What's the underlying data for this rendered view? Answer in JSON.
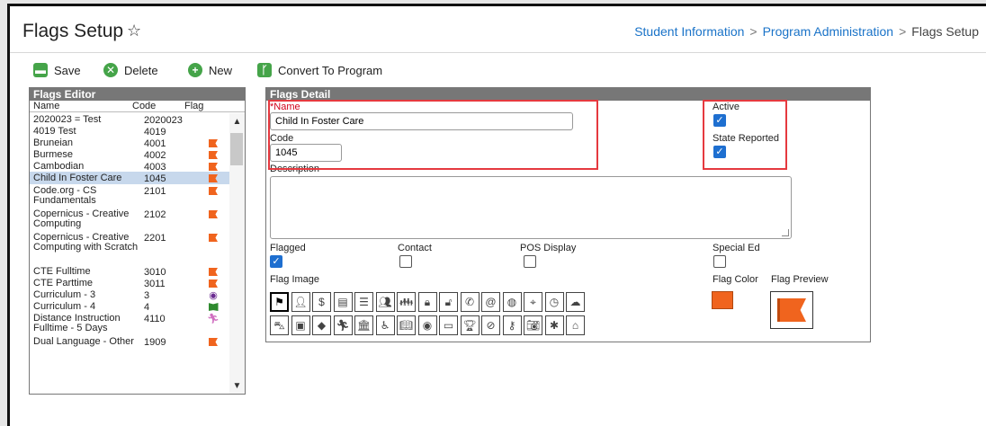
{
  "header": {
    "title": "Flags Setup",
    "breadcrumb": [
      "Student Information",
      "Program Administration",
      "Flags Setup"
    ]
  },
  "toolbar": {
    "save": "Save",
    "delete": "Delete",
    "new": "New",
    "convert": "Convert To Program"
  },
  "editor": {
    "title": "Flags Editor",
    "columns": {
      "name": "Name",
      "code": "Code",
      "flag": "Flag"
    },
    "rows": [
      {
        "name": "2020023 = Test",
        "code": "2020023",
        "flag": ""
      },
      {
        "name": "4019 Test",
        "code": "4019",
        "flag": ""
      },
      {
        "name": "Bruneian",
        "code": "4001",
        "flag": "flag"
      },
      {
        "name": "Burmese",
        "code": "4002",
        "flag": "flag"
      },
      {
        "name": "Cambodian",
        "code": "4003",
        "flag": "flag"
      },
      {
        "name": "Child In Foster Care",
        "code": "1045",
        "flag": "flag"
      },
      {
        "name": "Code.org - CS Fundamentals",
        "code": "2101",
        "flag": "flag"
      },
      {
        "name": "Copernicus - Creative Computing",
        "code": "2102",
        "flag": "flag"
      },
      {
        "name": "Copernicus - Creative Computing with Scratch",
        "code": "2201",
        "flag": "flag"
      },
      {
        "name": "CTE Fulltime",
        "code": "3010",
        "flag": "flag"
      },
      {
        "name": "CTE Parttime",
        "code": "3011",
        "flag": "flag"
      },
      {
        "name": "Curriculum - 3",
        "code": "3",
        "flag": "eye"
      },
      {
        "name": "Curriculum - 4",
        "code": "4",
        "flag": "book"
      },
      {
        "name": "Distance Instruction Fulltime - 5 Days",
        "code": "4110",
        "flag": "run"
      },
      {
        "name": "Dual Language - Other",
        "code": "1909",
        "flag": "flag"
      }
    ]
  },
  "detail": {
    "title": "Flags Detail",
    "name_label": "*Name",
    "name_value": "Child In Foster Care",
    "code_label": "Code",
    "code_value": "1045",
    "active_label": "Active",
    "state_reported_label": "State Reported",
    "description_label": "Description",
    "flagged_label": "Flagged",
    "contact_label": "Contact",
    "pos_display_label": "POS Display",
    "special_ed_label": "Special Ed",
    "flag_image_label": "Flag Image",
    "flag_color_label": "Flag Color",
    "flag_preview_label": "Flag Preview",
    "flag_color": "#f0641e",
    "checks": {
      "active": true,
      "state_reported": true,
      "flagged": true,
      "contact": false,
      "pos_display": false,
      "special_ed": false
    },
    "icons_row1": [
      "flag",
      "person-check",
      "dollar",
      "id-card",
      "list",
      "teacher",
      "group",
      "lock",
      "unlock",
      "phone",
      "at",
      "globe",
      "pin",
      "clock",
      "cloud"
    ],
    "icons_row2": [
      "car",
      "bus",
      "tag",
      "run",
      "bank",
      "wheelchair",
      "book",
      "eye",
      "monitor",
      "trophy",
      "ban",
      "key",
      "camera",
      "asterisk",
      "home"
    ]
  }
}
